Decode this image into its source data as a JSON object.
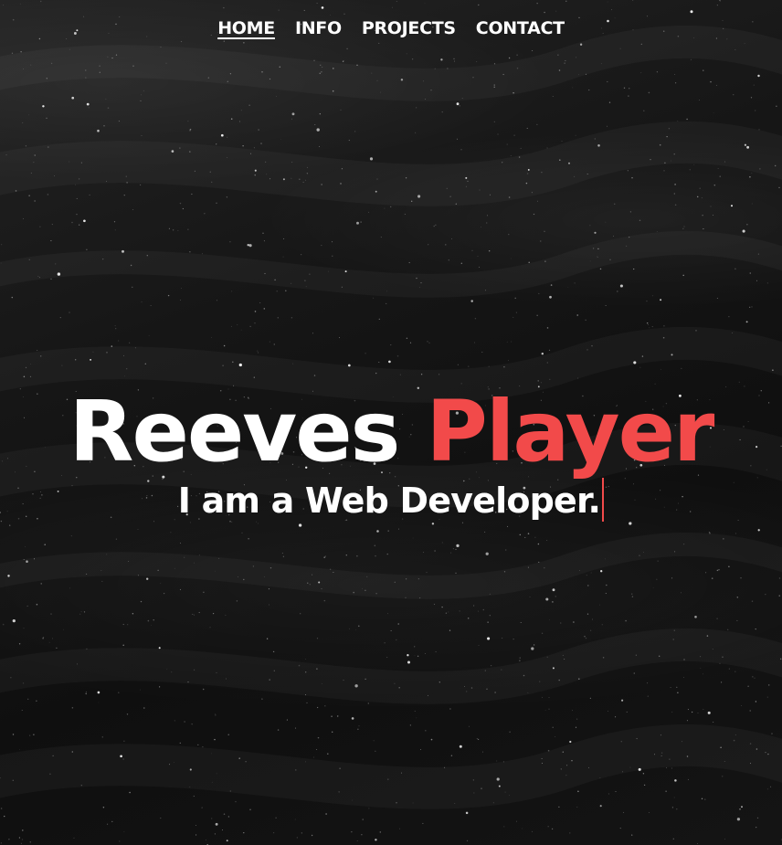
{
  "nav": {
    "items": [
      {
        "label": "HOME",
        "active": true
      },
      {
        "label": "INFO",
        "active": false
      },
      {
        "label": "PROJECTS",
        "active": false
      },
      {
        "label": "CONTACT",
        "active": false
      }
    ]
  },
  "hero": {
    "first_name": "Reeves",
    "last_name": "Player",
    "subtitle": "I am a Web Developer."
  },
  "colors": {
    "accent": "#f24a4a",
    "text": "#ffffff",
    "background": "#121212"
  },
  "background_image": "dark-sand-texture"
}
